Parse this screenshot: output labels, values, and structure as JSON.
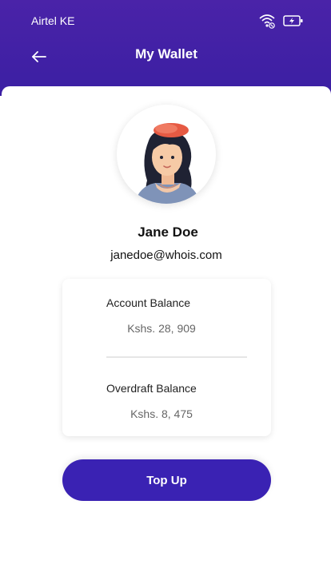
{
  "status_bar": {
    "carrier": "Airtel KE",
    "wifi_icon": "wifi-icon",
    "battery_icon": "battery-charging-icon"
  },
  "header": {
    "title": "My Wallet",
    "back_icon": "arrow-left-icon"
  },
  "colors": {
    "header_bg": "#3b1fa3",
    "button_bg": "#3a22b3",
    "text_dark": "#111111",
    "text_muted": "#666666"
  },
  "profile": {
    "name": "Jane Doe",
    "email": "janedoe@whois.com"
  },
  "balances": {
    "account_label": "Account Balance",
    "account_value": "Kshs. 28, 909",
    "overdraft_label": "Overdraft Balance",
    "overdraft_value": "Kshs. 8, 475"
  },
  "actions": {
    "topup_label": "Top Up"
  }
}
